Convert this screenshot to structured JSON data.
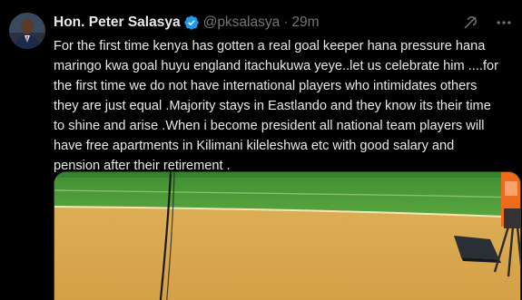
{
  "author": {
    "display_name": "Hon. Peter Salasya",
    "handle": "@pksalasya",
    "separator": "·",
    "timestamp": "29m",
    "verified_icon": "verified-badge-icon"
  },
  "header_actions": {
    "grok_icon": "grok-icon",
    "more_icon": "more-options-icon"
  },
  "tweet": {
    "lines": [
      "For the first time kenya has gotten a real goal keeper hana pressure hana",
      "maringo kwa goal huyu england itachukuwa yeye..let us celebrate him ....for",
      "the first time we do not have international players who intimidates others",
      "they are just equal .Majority stays in Eastlando and they know its their time",
      "to shine and arise .When i become president all national team players will",
      "have free apartments in Kilimani kileleshwa etc with good salary and",
      "pension after their  retirement ."
    ]
  },
  "media": {
    "type": "image",
    "subject": "stadium-pitch-photo"
  },
  "colors": {
    "background": "#000000",
    "text_primary": "#e7e9ea",
    "text_secondary": "#71767b",
    "verified_blue": "#1d9bf0",
    "pitch_green": "#4d9a3a",
    "track_orange": "#d9aa4f"
  }
}
